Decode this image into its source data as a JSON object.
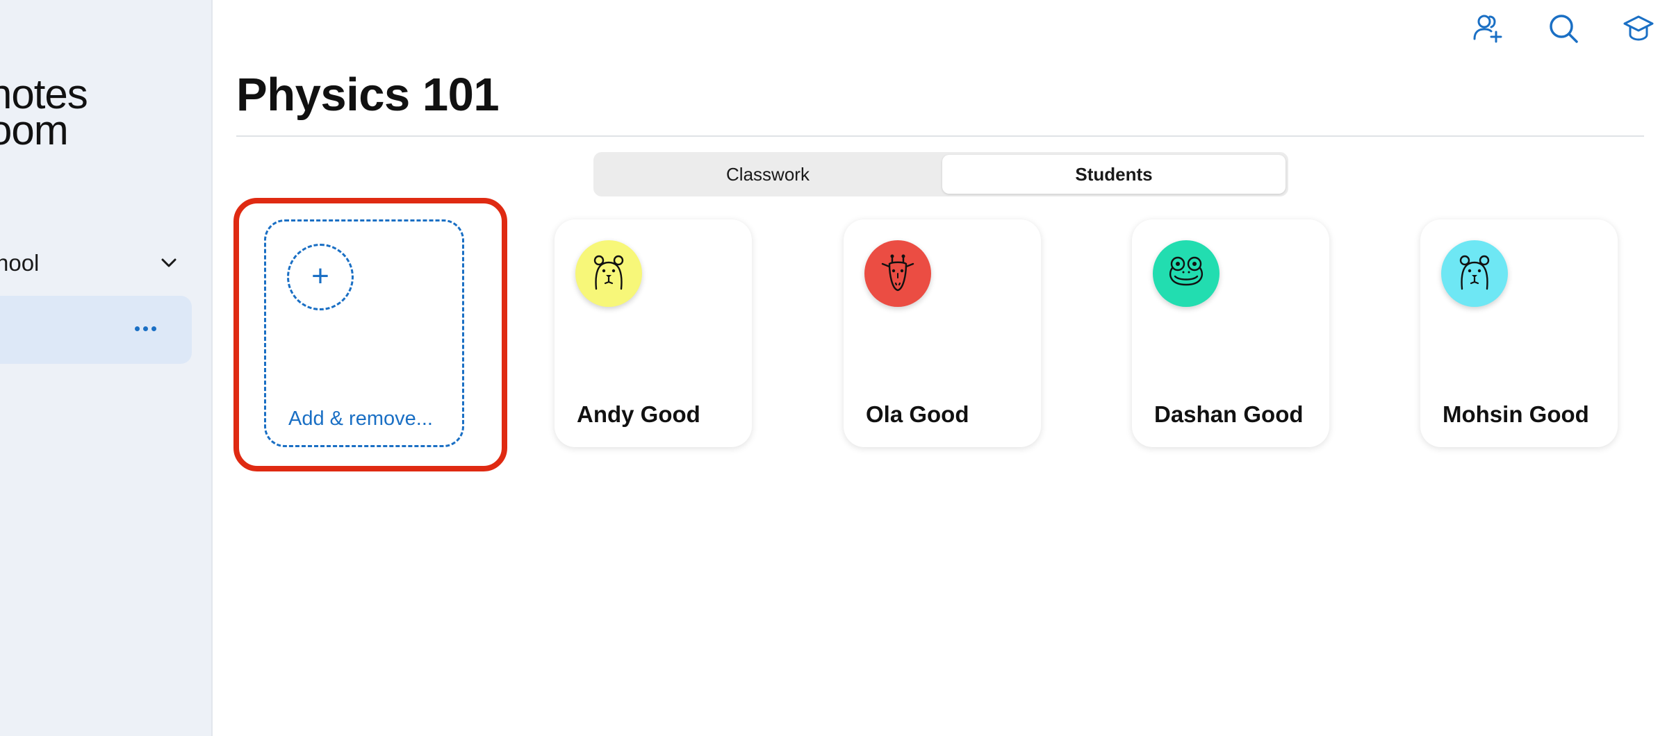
{
  "sidebar": {
    "brand_line1": "notes",
    "brand_line2": "oom",
    "school_label": "hool"
  },
  "header": {
    "title": "Physics 101",
    "icons": [
      "add-user-icon",
      "search-icon",
      "graduation-cap-icon"
    ]
  },
  "tabs": [
    {
      "label": "Classwork",
      "selected": false
    },
    {
      "label": "Students",
      "selected": true
    }
  ],
  "add_card": {
    "label": "Add & remove..."
  },
  "students": [
    {
      "name": "Andy Good",
      "avatar": "bear-icon",
      "color": "#f7f779"
    },
    {
      "name": "Ola Good",
      "avatar": "giraffe-icon",
      "color": "#eb4d43"
    },
    {
      "name": "Dashan Good",
      "avatar": "frog-icon",
      "color": "#22ddb0"
    },
    {
      "name": "Mohsin Good",
      "avatar": "bear-icon",
      "color": "#6ee7f4"
    }
  ],
  "colors": {
    "accent": "#1a6fc4",
    "highlight": "#df2a12",
    "sidebar_bg": "#edf1f7",
    "selected_item_bg": "#dde8f7"
  }
}
